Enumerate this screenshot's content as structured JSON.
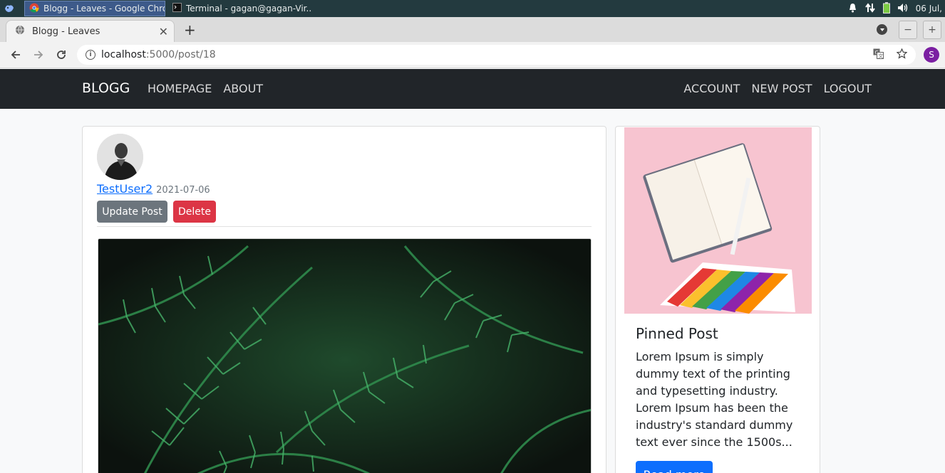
{
  "taskbar": {
    "tasks": [
      {
        "label": "Blogg - Leaves - Google Chro...",
        "icon": "chrome-icon",
        "active": true
      },
      {
        "label": "Terminal - gagan@gagan-Vir...",
        "icon": "terminal-icon",
        "active": false
      }
    ],
    "tray_icons": [
      "bell-icon",
      "network-arrows-icon",
      "battery-icon",
      "volume-icon"
    ],
    "clock": "06 Jul,"
  },
  "browser": {
    "tab_title": "Blogg - Leaves",
    "url_host": "localhost",
    "url_path": ":5000/post/18",
    "profile_initial": "S"
  },
  "navbar": {
    "brand": "BLOGG",
    "left_links": [
      "HOMEPAGE",
      "ABOUT"
    ],
    "right_links": [
      "ACCOUNT",
      "NEW POST",
      "LOGOUT"
    ]
  },
  "post": {
    "author": "TestUser2",
    "date": "2021-07-06",
    "update_label": "Update Post",
    "delete_label": "Delete"
  },
  "sidebar": {
    "title": "Pinned Post",
    "text": "Lorem Ipsum is simply dummy text of the printing and typesetting industry. Lorem Ipsum has been the industry's standard dummy text ever since the 1500s...",
    "button_label": "Read more"
  },
  "colors": {
    "navbar_bg": "#212529",
    "primary": "#0d6efd",
    "secondary": "#6c757d",
    "danger": "#dc3545"
  }
}
